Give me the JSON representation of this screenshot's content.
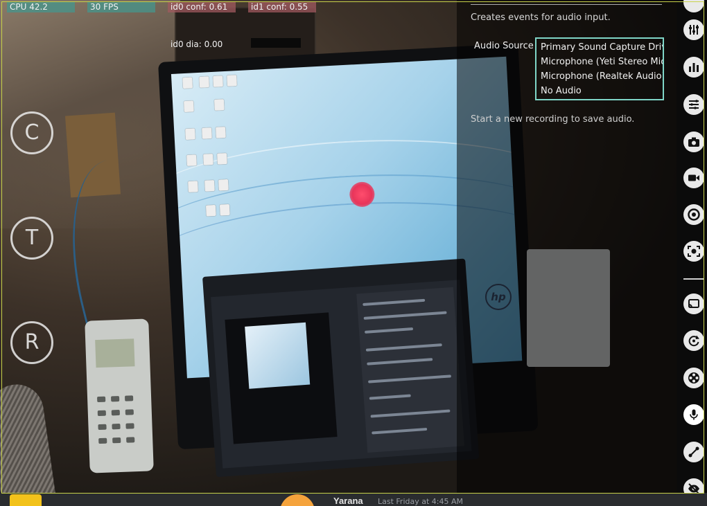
{
  "stats": {
    "cpu": "CPU 42.2",
    "fps": "30 FPS",
    "id0_conf": "id0 conf: 0.61",
    "id1_conf": "id1 conf: 0.55",
    "id0_dia": "id0 dia: 0.00"
  },
  "left_buttons": [
    {
      "label": "C"
    },
    {
      "label": "T"
    },
    {
      "label": "R"
    }
  ],
  "audio_panel": {
    "description": "Creates events for audio input.",
    "source_label": "Audio Source",
    "sources": [
      "Primary Sound Capture Driver",
      "Microphone (Yeti Stereo Microphone)",
      "Microphone (Realtek Audio)",
      "No Audio"
    ],
    "note": "Start a new recording to save audio."
  },
  "toolbar": {
    "icons": [
      "sliders-icon",
      "bar-chart-icon",
      "list-icon",
      "camera-icon",
      "video-icon",
      "record-icon",
      "screenshot-icon",
      "cast-icon",
      "rotate-icon",
      "film-reel-icon",
      "microphone-icon",
      "connection-icon",
      "eye-off-icon"
    ],
    "active": "microphone-icon",
    "accent": "#7fd6c8"
  },
  "bottom_strip": {
    "name": "Yarana",
    "time": "Last Friday at 4:45 AM"
  }
}
